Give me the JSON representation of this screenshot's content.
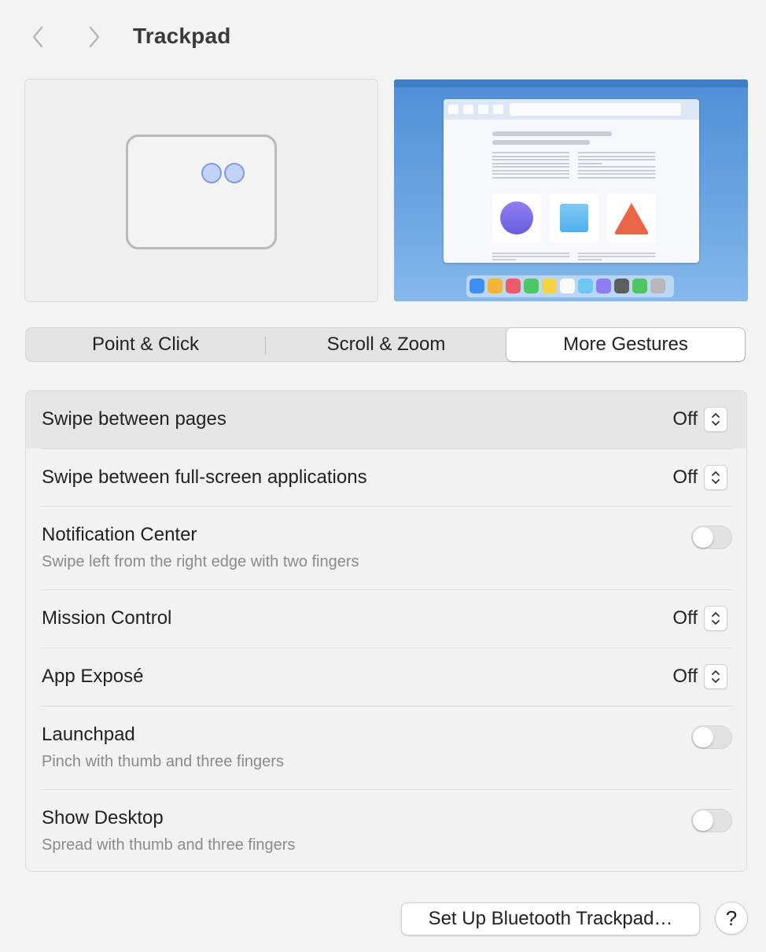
{
  "header": {
    "title": "Trackpad",
    "back_icon": "chevron-left-icon",
    "forward_icon": "chevron-right-icon"
  },
  "preview": {
    "accent_color": "#7f9be6",
    "desktop_color": "#4e8fd6"
  },
  "tabs": [
    {
      "label": "Point & Click",
      "active": false
    },
    {
      "label": "Scroll & Zoom",
      "active": false
    },
    {
      "label": "More Gestures",
      "active": true
    }
  ],
  "settings": [
    {
      "label": "Swipe between pages",
      "control": "popup",
      "value": "Off"
    },
    {
      "label": "Swipe between full-screen applications",
      "control": "popup",
      "value": "Off"
    },
    {
      "label": "Notification Center",
      "subtitle": "Swipe left from the right edge with two fingers",
      "control": "toggle",
      "on": false
    },
    {
      "label": "Mission Control",
      "control": "popup",
      "value": "Off"
    },
    {
      "label": "App Exposé",
      "control": "popup",
      "value": "Off"
    },
    {
      "label": "Launchpad",
      "subtitle": "Pinch with thumb and three fingers",
      "control": "toggle",
      "on": false
    },
    {
      "label": "Show Desktop",
      "subtitle": "Spread with thumb and three fingers",
      "control": "toggle",
      "on": false
    }
  ],
  "footer": {
    "setup_label": "Set Up Bluetooth Trackpad…",
    "help_label": "?"
  }
}
